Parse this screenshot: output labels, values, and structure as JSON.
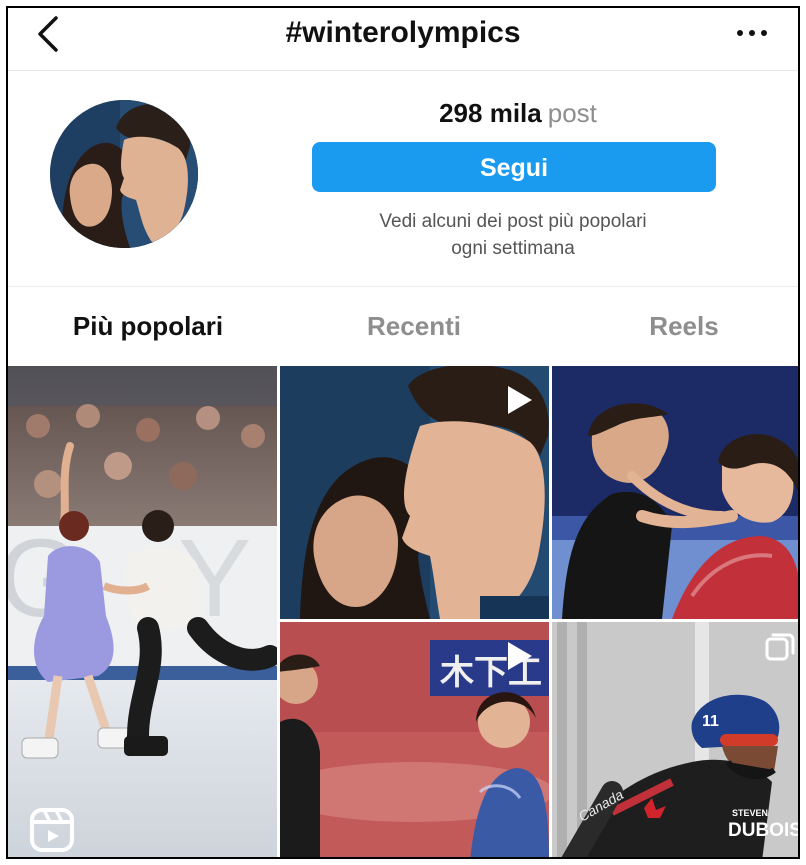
{
  "header": {
    "title": "#winterolympics",
    "back_icon": "chevron-left-icon",
    "more_icon": "more-horizontal-icon"
  },
  "profile": {
    "post_count": "298 mila",
    "post_unit": "post",
    "follow_label": "Segui",
    "hint_line1": "Vedi alcuni dei post più popolari",
    "hint_line2": "ogni settimana"
  },
  "tabs": [
    {
      "label": "Più popolari",
      "active": true
    },
    {
      "label": "Recenti",
      "active": false
    },
    {
      "label": "Reels",
      "active": false
    }
  ],
  "grid": {
    "tiles": [
      {
        "kind": "reel",
        "icon": "reels-icon",
        "subject": "ice-dance-pair"
      },
      {
        "kind": "video",
        "icon": "play-icon",
        "subject": "skaters-profile"
      },
      {
        "kind": "photo",
        "subject": "skaters-embrace"
      },
      {
        "kind": "video",
        "icon": "play-icon",
        "subject": "skaters-arena"
      },
      {
        "kind": "carousel",
        "icon": "carousel-icon",
        "subject": "speed-skater",
        "caption_small": "STEVEN",
        "caption_big": "DUBOIS",
        "helmet_number": "11"
      }
    ]
  },
  "colors": {
    "follow_button": "#1a9bf0",
    "muted_text": "#8e8e8e"
  }
}
